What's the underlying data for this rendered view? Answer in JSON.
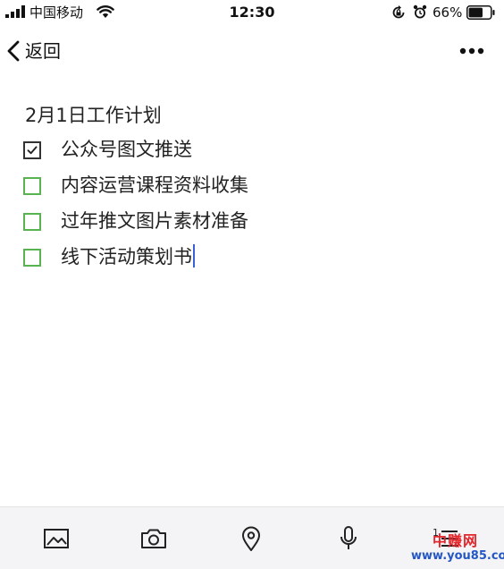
{
  "status_bar": {
    "carrier": "中国移动",
    "time": "12:30",
    "battery_percent": "66%",
    "battery_level": 0.66,
    "icons": [
      "signal-icon",
      "wifi-icon",
      "rotation-lock-icon",
      "alarm-icon",
      "battery-icon"
    ]
  },
  "nav": {
    "back_label": "返回",
    "more_icon": "more-horizontal-icon"
  },
  "note": {
    "title": "2月1日工作计划",
    "items": [
      {
        "text": "公众号图文推送",
        "checked": true
      },
      {
        "text": "内容运营课程资料收集",
        "checked": false
      },
      {
        "text": "过年推文图片素材准备",
        "checked": false
      },
      {
        "text": "线下活动策划书",
        "checked": false
      }
    ]
  },
  "toolbar": {
    "tools": [
      "image-icon",
      "camera-icon",
      "location-icon",
      "microphone-icon",
      "numbered-list-icon"
    ],
    "list_number": "1"
  },
  "watermark": {
    "brand": "中赚网",
    "url": "www.you85.com"
  },
  "colors": {
    "checkbox_green": "#58b351",
    "caret_blue": "#3b5fd6",
    "toolbar_bg": "#f4f4f6",
    "watermark_red": "#e3262b",
    "watermark_blue": "#2457c5"
  }
}
